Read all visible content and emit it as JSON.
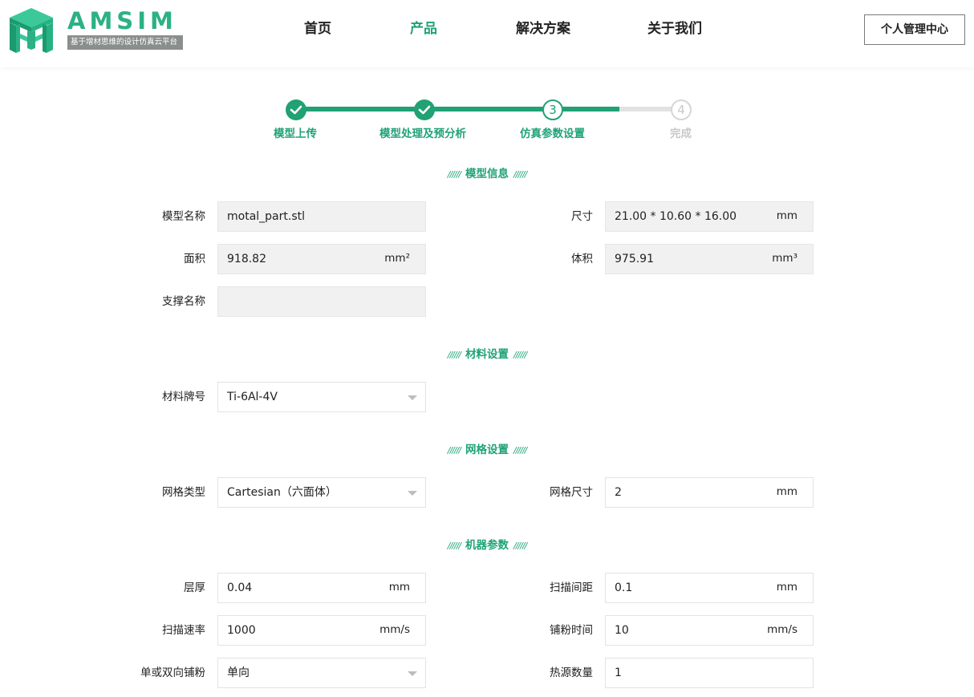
{
  "brand": {
    "name": "AMSIM",
    "tagline": "基于增材思维的设计仿真云平台",
    "color": "#2bb185"
  },
  "nav": {
    "items": [
      "首页",
      "产品",
      "解决方案",
      "关于我们"
    ],
    "active": "产品",
    "admin_button": "个人管理中心"
  },
  "steps": {
    "current": 3,
    "total": 4,
    "labels": [
      "模型上传",
      "模型处理及预分析",
      "仿真参数设置",
      "完成"
    ],
    "numbers": [
      "3",
      "4"
    ],
    "active_color": "#21a174",
    "inactive_color": "#d6d6d6"
  },
  "sections": {
    "model_info": "模型信息",
    "material": "材料设置",
    "mesh": "网格设置",
    "machine": "机器参数",
    "decoration": "//////"
  },
  "model_info": {
    "name_label": "模型名称",
    "name_value": "motal_part.stl",
    "size_label": "尺寸",
    "size_value": "21.00 * 10.60 * 16.00",
    "size_unit": "mm",
    "area_label": "面积",
    "area_value": "918.82",
    "area_unit": "mm²",
    "volume_label": "体积",
    "volume_value": "975.91",
    "volume_unit": "mm³",
    "support_label": "支撑名称",
    "support_value": ""
  },
  "material": {
    "grade_label": "材料牌号",
    "grade_value": "Ti-6Al-4V"
  },
  "mesh": {
    "type_label": "网格类型",
    "type_value": "Cartesian（六面体）",
    "size_label": "网格尺寸",
    "size_value": "2",
    "size_unit": "mm"
  },
  "machine": {
    "layer_label": "层厚",
    "layer_value": "0.04",
    "layer_unit": "mm",
    "hatch_label": "扫描间距",
    "hatch_value": "0.1",
    "hatch_unit": "mm",
    "speed_label": "扫描速率",
    "speed_value": "1000",
    "speed_unit": "mm/s",
    "recoat_label": "铺粉时间",
    "recoat_value": "10",
    "recoat_unit": "mm/s",
    "direction_label": "单或双向铺粉",
    "direction_value": "单向",
    "sources_label": "热源数量",
    "sources_value": "1"
  }
}
